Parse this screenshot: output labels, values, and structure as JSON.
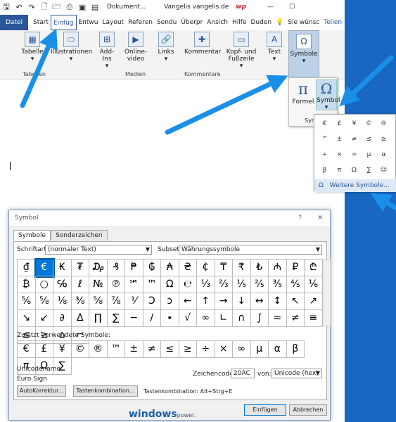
{
  "title_bar": {
    "quick_access_icons": [
      "save-icon",
      "undo-icon",
      "redo-icon",
      "new-doc-icon",
      "open-icon",
      "print-icon",
      "image-icon",
      "pdf-icon"
    ],
    "doc_title": "Dokument...",
    "user": "Vangelis vangelis.de",
    "brand": "wp",
    "controls": [
      "—",
      "☐"
    ]
  },
  "ribbon_tabs": {
    "datei": "Datei",
    "items": [
      "Start",
      "Einfüg",
      "Entwu",
      "Layout",
      "Referen",
      "Sendu",
      "Überpr",
      "Ansich",
      "Hilfe",
      "Duden"
    ],
    "search": "Sie wünsc",
    "share": "Teilen"
  },
  "ribbon": {
    "groups": [
      {
        "label": "Tabelle",
        "icon": "▦",
        "caret": "▾"
      },
      {
        "label": "Illustrationen",
        "icon": "⬭",
        "caret": "▾"
      },
      {
        "label": "Add-Ins",
        "icon": "⊞",
        "caret": "▾"
      },
      {
        "label": "Online-video",
        "icon": "▶"
      },
      {
        "label": "Links",
        "icon": "🔗",
        "caret": "▾"
      },
      {
        "label": "Kommentar",
        "icon": "✚"
      },
      {
        "label": "Kopf- und Fußzeile",
        "icon": "▭",
        "caret": "▾"
      },
      {
        "label": "Text",
        "icon": "A",
        "caret": "▾"
      },
      {
        "label": "Symbole",
        "icon": "Ω",
        "caret": "▾"
      }
    ],
    "group_labels": {
      "tabellen": "Tabellen",
      "medien": "Medien",
      "kommentare": "Kommentare"
    }
  },
  "symbol_dropdown": {
    "formel": {
      "label": "Formel",
      "icon": "π"
    },
    "symbol": {
      "label": "Symbol",
      "icon": "Ω"
    },
    "group": "Sym",
    "caret": "▾"
  },
  "symbol_gallery": {
    "symbols": [
      "€",
      "£",
      "¥",
      "©",
      "®",
      "™",
      "±",
      "≠",
      "≤",
      "≥",
      "÷",
      "×",
      "∞",
      "µ",
      "α",
      "β",
      "π",
      "Ω",
      "∑",
      "☺"
    ],
    "more": "Weitere Symbole...",
    "more_icon": "Ω"
  },
  "dialog": {
    "title": "Symbol",
    "help": "?",
    "close": "✕",
    "tabs": [
      "Symbole",
      "Sonderzeichen"
    ],
    "font_label": "Schriftart:",
    "font_value": "(normaler Text)",
    "subset_label": "Subset:",
    "subset_value": "Währungssymbole",
    "chars": [
      "₫",
      "€",
      "₭",
      "₮",
      "₯",
      "₰",
      "₱",
      "₲",
      "₳",
      "₴",
      "₵",
      "₸",
      "₹",
      "₺",
      "₼",
      "₽",
      "₾",
      "₿",
      "○",
      "℅",
      "ℓ",
      "№",
      "℗",
      "℠",
      "™",
      "Ω",
      "℮",
      "⅓",
      "⅔",
      "⅕",
      "⅖",
      "⅗",
      "⅘",
      "⅙",
      "⅚",
      "⅝",
      "⅛",
      "⅜",
      "⅝",
      "⅞",
      "⅟",
      "Ↄ",
      "ↄ",
      "←",
      "↑",
      "→",
      "↓",
      "↔",
      "↕",
      "↖",
      "↗",
      "↘",
      "↙",
      "∂",
      "Δ",
      "∏",
      "∑",
      "−",
      "∕",
      "∙",
      "√",
      "∞",
      "∟",
      "∩",
      "∫",
      "≈",
      "≠",
      "≡",
      "≤",
      "≥",
      "⌂",
      "⌐"
    ],
    "selected_index": 1,
    "recent_label": "Zuletzt verwendete Symbole:",
    "recent": [
      "€",
      "£",
      "¥",
      "©",
      "®",
      "™",
      "±",
      "≠",
      "≤",
      "≥",
      "÷",
      "×",
      "∞",
      "µ",
      "α",
      "β",
      "π",
      "Ω",
      "∑"
    ],
    "unicode_name_label": "Unicodename:",
    "unicode_name": "Euro Sign",
    "charcode_label": "Zeichencode:",
    "charcode": "20AC",
    "from_label": "von:",
    "from_value": "Unicode (hex)",
    "autocorrect": "AutoKorrektur...",
    "shortcut_btn": "Tastenkombination...",
    "shortcut_text": "Tastenkombination: Alt+Strg+E",
    "insert": "Einfügen",
    "cancel": "Abbrechen"
  },
  "watermark": {
    "main": "windows",
    "sub": "power."
  },
  "arrow_color": "#1a8fe8"
}
